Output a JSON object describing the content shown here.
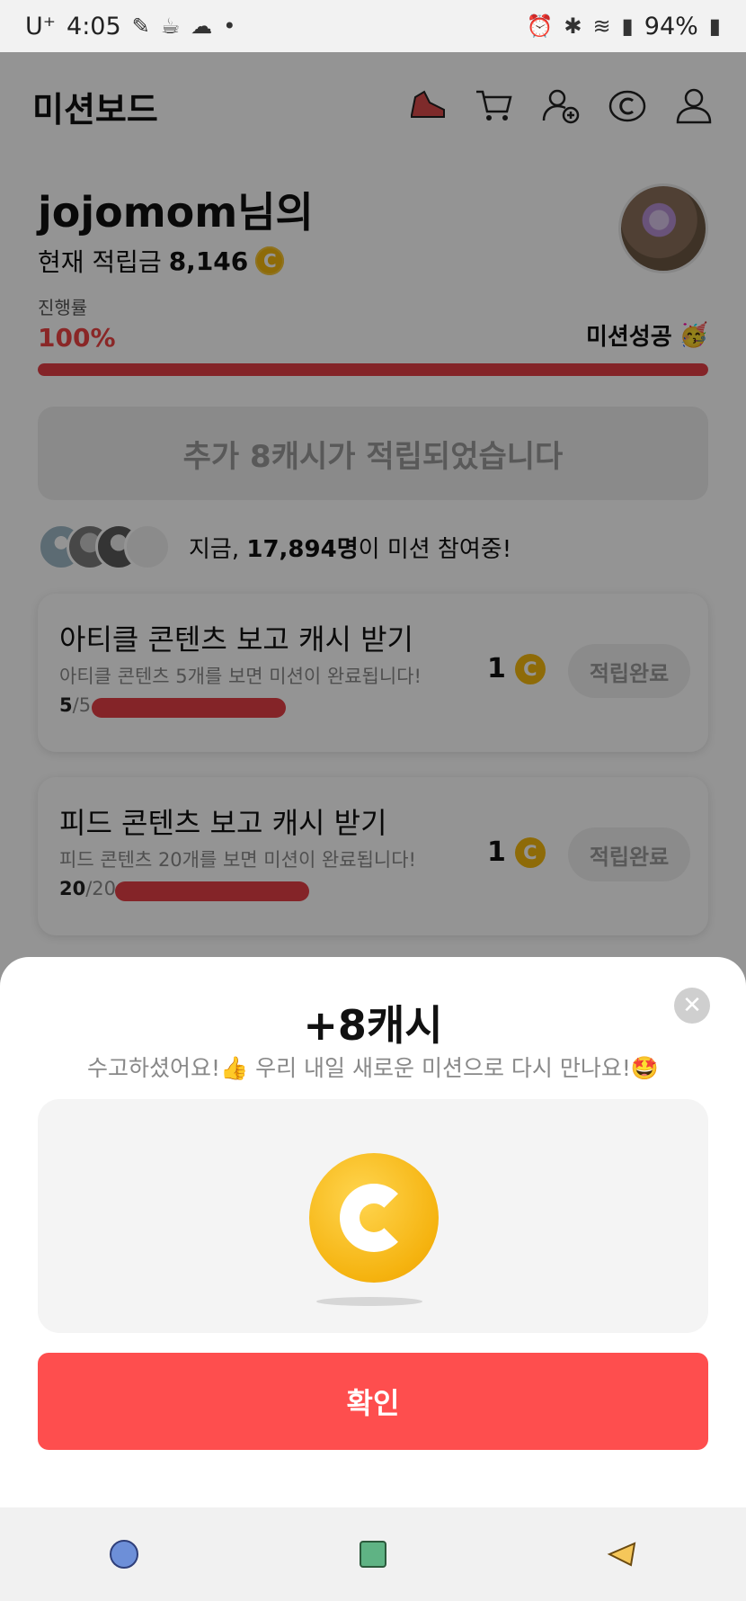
{
  "status_bar": {
    "carrier": "U⁺",
    "time": "4:05",
    "battery": "94%"
  },
  "header": {
    "title": "미션보드"
  },
  "profile": {
    "username": "jojomom님의",
    "balance_label": "현재 적립금",
    "balance_value": "8,146",
    "coin_glyph": "C"
  },
  "progress": {
    "label": "진행률",
    "percent_text": "100%",
    "value": 1.0,
    "status": "미션성공",
    "emoji": "🥳"
  },
  "banner": {
    "text": "추가 8캐시가 적립되었습니다"
  },
  "participants": {
    "prefix": "지금, ",
    "count": "17,894명",
    "suffix": "이 미션 참여중!"
  },
  "missions": [
    {
      "title": "아티클 콘텐츠 보고 캐시 받기",
      "subtitle": "아티클 콘텐츠 5개를 보면 미션이 완료됩니다!",
      "current": "5",
      "total": "/5",
      "reward": "1",
      "coin_glyph": "C",
      "button": "적립완료"
    },
    {
      "title": "피드 콘텐츠 보고 캐시 받기",
      "subtitle": "피드 콘텐츠 20개를 보면 미션이 완료됩니다!",
      "current": "20",
      "total": "/20",
      "reward": "1",
      "coin_glyph": "C",
      "button": "적립완료"
    }
  ],
  "modal": {
    "title": "+8캐시",
    "subtitle": "수고하셨어요!👍 우리 내일 새로운 미션으로 다시 만나요!🤩",
    "confirm_label": "확인",
    "close_glyph": "✕"
  },
  "colors": {
    "accent": "#fe4e4e",
    "progress": "#e43f46",
    "coin": "#f5b90f"
  }
}
